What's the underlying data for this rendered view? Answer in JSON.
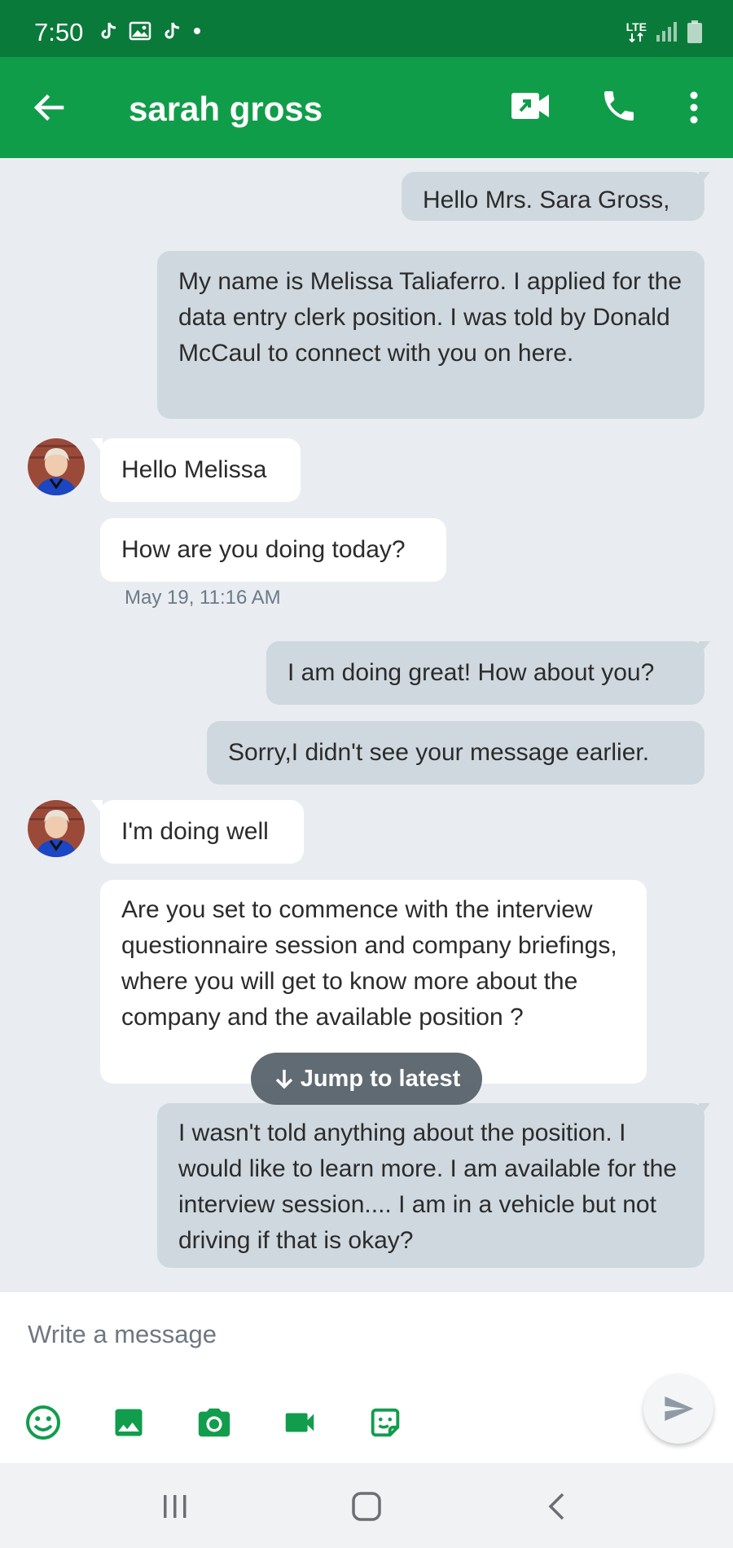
{
  "status_bar": {
    "time": "7:50",
    "network": "LTE",
    "icons": [
      "tiktok-icon",
      "image-icon",
      "tiktok-icon",
      "notification-dot-icon",
      "lte-icon",
      "signal-icon",
      "battery-icon"
    ]
  },
  "header": {
    "title": "sarah gross",
    "icons": [
      "back-arrow-icon",
      "video-call-icon",
      "phone-icon",
      "more-vert-icon"
    ]
  },
  "messages": [
    {
      "sender": "me",
      "text": "Hello Mrs. Sara Gross,"
    },
    {
      "sender": "me",
      "text": "My name is Melissa Taliaferro.  I applied for the data entry clerk position.  I was told by Donald McCaul to connect with you on here."
    },
    {
      "sender": "them",
      "text": "Hello Melissa"
    },
    {
      "sender": "them",
      "text": "How are you doing today?"
    },
    {
      "sender": "me",
      "text": "I am doing great! How about you?"
    },
    {
      "sender": "me",
      "text": "Sorry,I didn't  see your message earlier."
    },
    {
      "sender": "them",
      "text": "I'm doing well"
    },
    {
      "sender": "them",
      "text": "Are you set to commence with the interview questionnaire session and company briefings, where you will get to know more about the company and the available position ?"
    },
    {
      "sender": "me",
      "text": "I wasn't told anything about the position.  I would like to learn more. I am available for the interview session.... I am in a vehicle  but not driving if that is okay?"
    }
  ],
  "timestamp": "May 19, 11:16 AM",
  "jump_to_latest": "Jump to latest",
  "composer": {
    "placeholder": "Write a message",
    "attach_icons": [
      "emoji-icon",
      "gallery-icon",
      "camera-icon",
      "video-icon",
      "sticker-icon"
    ],
    "send_icon": "send-icon"
  },
  "nav_bar": {
    "icons": [
      "recent-apps-icon",
      "home-icon",
      "back-icon"
    ]
  },
  "colors": {
    "status_bar": "#0a7a3a",
    "app_bar": "#109d4a",
    "chat_background": "#e9edf1",
    "outgoing_bubble": "#cfd8df",
    "incoming_bubble": "#ffffff",
    "jump_button": "#546068"
  }
}
